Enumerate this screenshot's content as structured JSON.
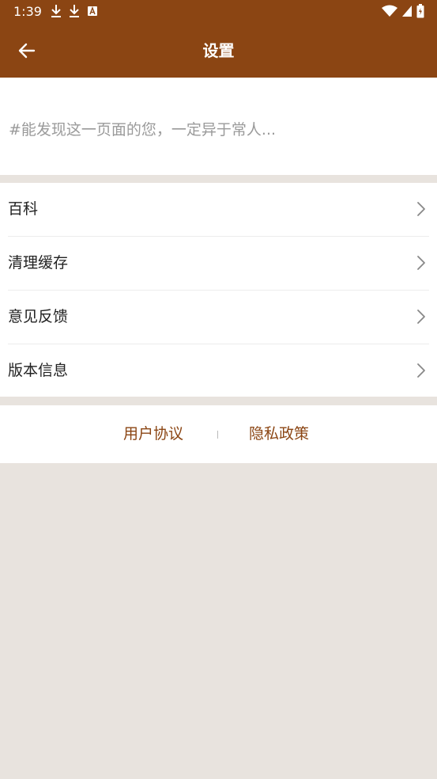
{
  "status_bar": {
    "time": "1:39",
    "left_icons": [
      "download-icon",
      "download-icon",
      "text-a-icon"
    ],
    "right_icons": [
      "wifi-icon",
      "signal-icon",
      "battery-icon"
    ]
  },
  "app_bar": {
    "title": "设置",
    "back_icon": "arrow-left-icon",
    "background": "#8b4513"
  },
  "tagline": "#能发现这一页面的您，一定异于常人...",
  "menu": {
    "items": [
      {
        "label": "百科"
      },
      {
        "label": "清理缓存"
      },
      {
        "label": "意见反馈"
      },
      {
        "label": "版本信息"
      }
    ],
    "chevron_icon": "chevron-right-icon"
  },
  "footer": {
    "user_agreement": "用户协议",
    "privacy_policy": "隐私政策",
    "link_color": "#8b4513"
  },
  "colors": {
    "page_background": "#e8e3de",
    "card_background": "#ffffff"
  }
}
